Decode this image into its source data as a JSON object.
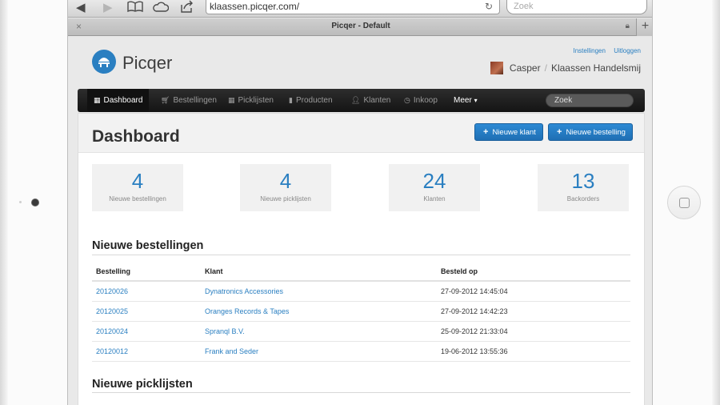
{
  "browser": {
    "url": "klaassen.picqer.com/",
    "search_placeholder": "Zoek",
    "tab_title": "Picqer - Default",
    "icons": {
      "back": "back-arrow-icon",
      "forward": "forward-arrow-icon",
      "bookmarks": "book-icon",
      "icloud": "cloud-icon",
      "share": "share-icon",
      "reload": "reload-icon",
      "close_tab": "close-icon",
      "new_tab": "plus-icon",
      "lock": "lock-icon"
    }
  },
  "header": {
    "logo_text": "Picqer",
    "links": {
      "settings": "Instellingen",
      "logout": "Uitloggen"
    },
    "user_name": "Casper",
    "company": "Klaassen Handelsmij"
  },
  "nav": {
    "items": [
      {
        "label": "Dashboard",
        "icon": "grid-icon",
        "active": true
      },
      {
        "label": "Bestellingen",
        "icon": "cart-icon"
      },
      {
        "label": "Picklijsten",
        "icon": "list-grid-icon"
      },
      {
        "label": "Producten",
        "icon": "document-icon"
      },
      {
        "label": "Klanten",
        "icon": "user-icon"
      },
      {
        "label": "Inkoop",
        "icon": "clock-icon"
      },
      {
        "label": "Meer",
        "icon": "caret-down-icon"
      }
    ],
    "search_placeholder": "Zoek"
  },
  "dashboard": {
    "title": "Dashboard",
    "buttons": {
      "new_customer": "Nieuwe klant",
      "new_order": "Nieuwe bestelling"
    },
    "stats": [
      {
        "value": "4",
        "label": "Nieuwe bestellingen"
      },
      {
        "value": "4",
        "label": "Nieuwe picklijsten"
      },
      {
        "value": "24",
        "label": "Klanten"
      },
      {
        "value": "13",
        "label": "Backorders"
      }
    ],
    "orders_section": {
      "title": "Nieuwe bestellingen",
      "columns": [
        "Bestelling",
        "Klant",
        "Besteld op"
      ],
      "rows": [
        {
          "order": "20120026",
          "customer": "Dynatronics Accessories",
          "date": "27-09-2012 14:45:04"
        },
        {
          "order": "20120025",
          "customer": "Oranges Records & Tapes",
          "date": "27-09-2012 14:42:23"
        },
        {
          "order": "20120024",
          "customer": "Spranql B.V.",
          "date": "25-09-2012 21:33:04"
        },
        {
          "order": "20120012",
          "customer": "Frank and Seder",
          "date": "19-06-2012 13:55:36"
        }
      ]
    },
    "picklists_section": {
      "title": "Nieuwe picklijsten"
    }
  },
  "colors": {
    "accent": "#2a7fc1",
    "navbar": "#1c1c1c",
    "button": "#2580c9"
  }
}
